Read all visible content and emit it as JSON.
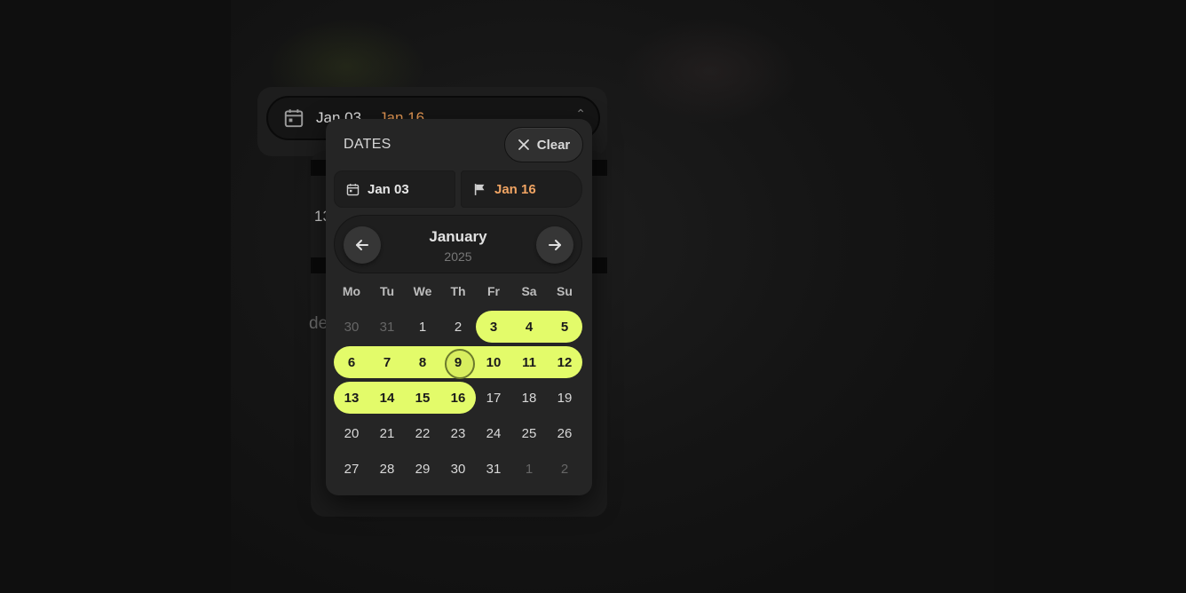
{
  "trigger": {
    "start_label": "Jan 03",
    "end_label": "Jan 16"
  },
  "background_fragments": {
    "frag_1": "13",
    "frag_2": "de"
  },
  "popover": {
    "title": "DATES",
    "clear_label": "Clear",
    "start_field": "Jan 03",
    "end_field": "Jan 16",
    "month": "January",
    "year": "2025",
    "weekdays": [
      "Mo",
      "Tu",
      "We",
      "Th",
      "Fr",
      "Sa",
      "Su"
    ],
    "weeks": [
      [
        {
          "d": "30",
          "muted": true
        },
        {
          "d": "31",
          "muted": true
        },
        {
          "d": "1"
        },
        {
          "d": "2"
        },
        {
          "d": "3",
          "sel": true
        },
        {
          "d": "4",
          "sel": true
        },
        {
          "d": "5",
          "sel": true
        }
      ],
      [
        {
          "d": "6",
          "sel": true
        },
        {
          "d": "7",
          "sel": true
        },
        {
          "d": "8",
          "sel": true
        },
        {
          "d": "9",
          "sel": true,
          "today": true
        },
        {
          "d": "10",
          "sel": true
        },
        {
          "d": "11",
          "sel": true
        },
        {
          "d": "12",
          "sel": true
        }
      ],
      [
        {
          "d": "13",
          "sel": true
        },
        {
          "d": "14",
          "sel": true
        },
        {
          "d": "15",
          "sel": true
        },
        {
          "d": "16",
          "sel": true
        },
        {
          "d": "17"
        },
        {
          "d": "18"
        },
        {
          "d": "19"
        }
      ],
      [
        {
          "d": "20"
        },
        {
          "d": "21"
        },
        {
          "d": "22"
        },
        {
          "d": "23"
        },
        {
          "d": "24"
        },
        {
          "d": "25"
        },
        {
          "d": "26"
        }
      ],
      [
        {
          "d": "27"
        },
        {
          "d": "28"
        },
        {
          "d": "29"
        },
        {
          "d": "30"
        },
        {
          "d": "31"
        },
        {
          "d": "1",
          "muted": true
        },
        {
          "d": "2",
          "muted": true
        }
      ]
    ]
  },
  "colors": {
    "accent": "#e3fb6a",
    "end_date": "#f0a463",
    "panel": "#252525"
  },
  "icons": {
    "calendar": "calendar-icon",
    "flag": "flag-icon",
    "close": "close-icon",
    "arrow_left": "arrow-left-icon",
    "arrow_right": "arrow-right-icon"
  }
}
